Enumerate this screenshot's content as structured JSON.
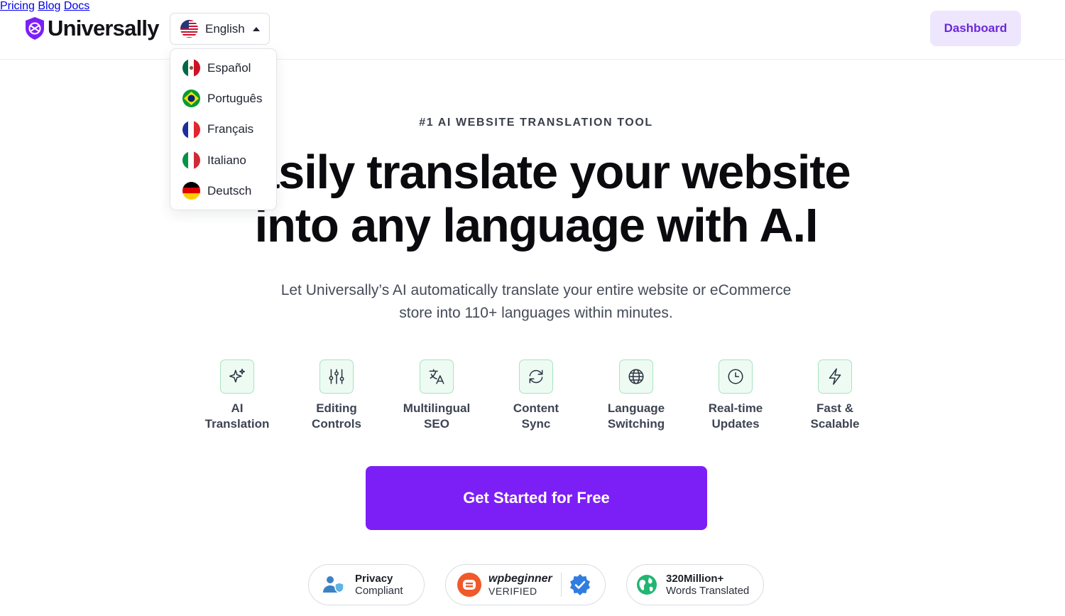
{
  "header": {
    "brand": "Universally",
    "language": {
      "current": "English",
      "options": [
        "Español",
        "Português",
        "Français",
        "Italiano",
        "Deutsch"
      ]
    },
    "nav": [
      "Pricing",
      "Blog",
      "Docs"
    ],
    "dashboard_label": "Dashboard"
  },
  "hero": {
    "eyebrow": "#1 AI WEBSITE TRANSLATION TOOL",
    "headline_line1": "Easily translate your website",
    "headline_line2": "into any language with A.I",
    "subtitle_line1": "Let Universally’s AI automatically translate your entire website or eCommerce",
    "subtitle_line2": "store into 110+ languages within minutes."
  },
  "features": [
    {
      "line1": "AI",
      "line2": "Translation",
      "icon": "sparkles-icon"
    },
    {
      "line1": "Editing",
      "line2": "Controls",
      "icon": "sliders-icon"
    },
    {
      "line1": "Multilingual",
      "line2": "SEO",
      "icon": "translate-icon"
    },
    {
      "line1": "Content",
      "line2": "Sync",
      "icon": "refresh-icon"
    },
    {
      "line1": "Language",
      "line2": "Switching",
      "icon": "globe-icon"
    },
    {
      "line1": "Real-time",
      "line2": "Updates",
      "icon": "clock-icon"
    },
    {
      "line1": "Fast &",
      "line2": "Scalable",
      "icon": "bolt-icon"
    }
  ],
  "cta_label": "Get Started for Free",
  "badges": {
    "privacy": {
      "line1": "Privacy",
      "line2": "Compliant"
    },
    "wpbeginner": {
      "line1": "wpbeginner",
      "line2": "VERIFIED"
    },
    "words": {
      "line1": "320Million+",
      "line2": "Words Translated"
    }
  },
  "colors": {
    "accent": "#7c1ff7",
    "dashboard_bg": "#ede6fd",
    "dashboard_text": "#6d28d9",
    "icon_green": "#22c55e"
  }
}
